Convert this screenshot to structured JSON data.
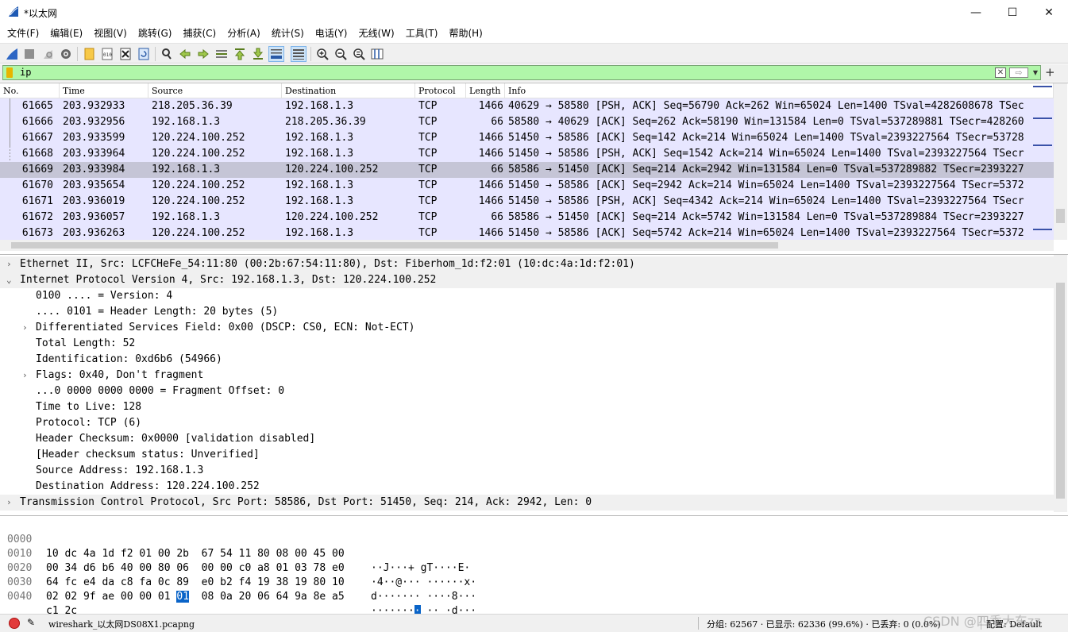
{
  "window": {
    "title": "*以太网",
    "minimize": "—",
    "maximize": "☐",
    "close": "✕"
  },
  "menu": [
    "文件(F)",
    "编辑(E)",
    "视图(V)",
    "跳转(G)",
    "捕获(C)",
    "分析(A)",
    "统计(S)",
    "电话(Y)",
    "无线(W)",
    "工具(T)",
    "帮助(H)"
  ],
  "toolbar_icons": {
    "start": "shark-fin-icon",
    "stop": "stop-icon",
    "restart": "restart-icon",
    "options": "gear-icon",
    "open": "folder-icon",
    "save": "save-icon",
    "close_file": "close-file-icon",
    "reload": "reload-icon",
    "find": "find-icon",
    "back": "back-icon",
    "forward": "forward-icon",
    "goto": "goto-icon",
    "first": "first-icon",
    "last": "last-icon",
    "autoscroll": "autoscroll-icon",
    "colorize": "colorize-icon",
    "zoom_in": "zoom-in-icon",
    "zoom_out": "zoom-out-icon",
    "zoom_reset": "zoom-reset-icon",
    "resize_cols": "resize-columns-icon"
  },
  "filter": {
    "value": "ip",
    "apply_glyph": "⇨",
    "plus": "+"
  },
  "packet_list": {
    "columns": [
      "No.",
      "Time",
      "Source",
      "Destination",
      "Protocol",
      "Length",
      "Info"
    ],
    "rows": [
      {
        "no": "61665",
        "time": "203.932933",
        "src": "218.205.36.39",
        "dst": "192.168.1.3",
        "proto": "TCP",
        "len": "1466",
        "info": "40629 → 58580 [PSH, ACK] Seq=56790 Ack=262 Win=65024 Len=1400 TSval=4282608678 TSec"
      },
      {
        "no": "61666",
        "time": "203.932956",
        "src": "192.168.1.3",
        "dst": "218.205.36.39",
        "proto": "TCP",
        "len": "66",
        "info": "58580 → 40629 [ACK] Seq=262 Ack=58190 Win=131584 Len=0 TSval=537289881 TSecr=428260"
      },
      {
        "no": "61667",
        "time": "203.933599",
        "src": "120.224.100.252",
        "dst": "192.168.1.3",
        "proto": "TCP",
        "len": "1466",
        "info": "51450 → 58586 [ACK] Seq=142 Ack=214 Win=65024 Len=1400 TSval=2393227564 TSecr=53728"
      },
      {
        "no": "61668",
        "time": "203.933964",
        "src": "120.224.100.252",
        "dst": "192.168.1.3",
        "proto": "TCP",
        "len": "1466",
        "info": "51450 → 58586 [PSH, ACK] Seq=1542 Ack=214 Win=65024 Len=1400 TSval=2393227564 TSecr"
      },
      {
        "no": "61669",
        "time": "203.933984",
        "src": "192.168.1.3",
        "dst": "120.224.100.252",
        "proto": "TCP",
        "len": "66",
        "info": "58586 → 51450 [ACK] Seq=214 Ack=2942 Win=131584 Len=0 TSval=537289882 TSecr=2393227"
      },
      {
        "no": "61670",
        "time": "203.935654",
        "src": "120.224.100.252",
        "dst": "192.168.1.3",
        "proto": "TCP",
        "len": "1466",
        "info": "51450 → 58586 [ACK] Seq=2942 Ack=214 Win=65024 Len=1400 TSval=2393227564 TSecr=5372"
      },
      {
        "no": "61671",
        "time": "203.936019",
        "src": "120.224.100.252",
        "dst": "192.168.1.3",
        "proto": "TCP",
        "len": "1466",
        "info": "51450 → 58586 [PSH, ACK] Seq=4342 Ack=214 Win=65024 Len=1400 TSval=2393227564 TSecr"
      },
      {
        "no": "61672",
        "time": "203.936057",
        "src": "192.168.1.3",
        "dst": "120.224.100.252",
        "proto": "TCP",
        "len": "66",
        "info": "58586 → 51450 [ACK] Seq=214 Ack=5742 Win=131584 Len=0 TSval=537289884 TSecr=2393227"
      },
      {
        "no": "61673",
        "time": "203.936263",
        "src": "120.224.100.252",
        "dst": "192.168.1.3",
        "proto": "TCP",
        "len": "1466",
        "info": "51450 → 58586 [ACK] Seq=5742 Ack=214 Win=65024 Len=1400 TSval=2393227564 TSecr=5372"
      }
    ]
  },
  "details": [
    {
      "arrow": "›",
      "text": "Ethernet II, Src: LCFCHeFe_54:11:80 (00:2b:67:54:11:80), Dst: Fiberhom_1d:f2:01 (10:dc:4a:1d:f2:01)"
    },
    {
      "arrow": "⌄",
      "text": "Internet Protocol Version 4, Src: 192.168.1.3, Dst: 120.224.100.252"
    },
    {
      "arrow": "",
      "text": "0100 .... = Version: 4"
    },
    {
      "arrow": "",
      "text": ".... 0101 = Header Length: 20 bytes (5)"
    },
    {
      "arrow": "›",
      "text": "Differentiated Services Field: 0x00 (DSCP: CS0, ECN: Not-ECT)"
    },
    {
      "arrow": "",
      "text": "Total Length: 52"
    },
    {
      "arrow": "",
      "text": "Identification: 0xd6b6 (54966)"
    },
    {
      "arrow": "›",
      "text": "Flags: 0x40, Don't fragment"
    },
    {
      "arrow": "",
      "text": "...0 0000 0000 0000 = Fragment Offset: 0"
    },
    {
      "arrow": "",
      "text": "Time to Live: 128"
    },
    {
      "arrow": "",
      "text": "Protocol: TCP (6)"
    },
    {
      "arrow": "",
      "text": "Header Checksum: 0x0000 [validation disabled]"
    },
    {
      "arrow": "",
      "text": "[Header checksum status: Unverified]"
    },
    {
      "arrow": "",
      "text": "Source Address: 192.168.1.3"
    },
    {
      "arrow": "",
      "text": "Destination Address: 120.224.100.252"
    },
    {
      "arrow": "›",
      "text": "Transmission Control Protocol, Src Port: 58586, Dst Port: 51450, Seq: 214, Ack: 2942, Len: 0"
    }
  ],
  "bytes": [
    {
      "offset": "0000",
      "hex": "10 dc 4a 1d f2 01 00 2b  67 54 11 80 08 00 45 00",
      "ascii": "··J···+ gT····E·"
    },
    {
      "offset": "0010",
      "hex": "00 34 d6 b6 40 00 80 06  00 00 c0 a8 01 03 78 e0",
      "ascii": "·4··@··· ······x·"
    },
    {
      "offset": "0020",
      "hex": "64 fc e4 da c8 fa 0c 89  e0 b2 f4 19 38 19 80 10",
      "ascii": "d······· ····8···"
    },
    {
      "offset": "0030",
      "hex_pre": "02 02 9f ae 00 00 01 ",
      "hex_hl": "01",
      "hex_post": "  08 0a 20 06 64 9a 8e a5",
      "ascii_pre": "·······",
      "ascii_hl": "·",
      "ascii_post": " ·· ·d···"
    },
    {
      "offset": "0040",
      "hex": "c1 2c",
      "ascii": "·,"
    }
  ],
  "status": {
    "file": "wireshark_以太网DS08X1.pcapng",
    "stats": "分组: 62567 · 已显示: 62336 (99.6%) · 已丢弃: 0 (0.0%)",
    "profile": "配置: Default",
    "watermark": "CSDN @四季大东zz"
  },
  "colors": {
    "row_tcp": "#e7e6ff",
    "row_selected": "#c5c5d6",
    "filter_valid": "#b0f6a9",
    "byte_highlight": "#0a64c8"
  }
}
